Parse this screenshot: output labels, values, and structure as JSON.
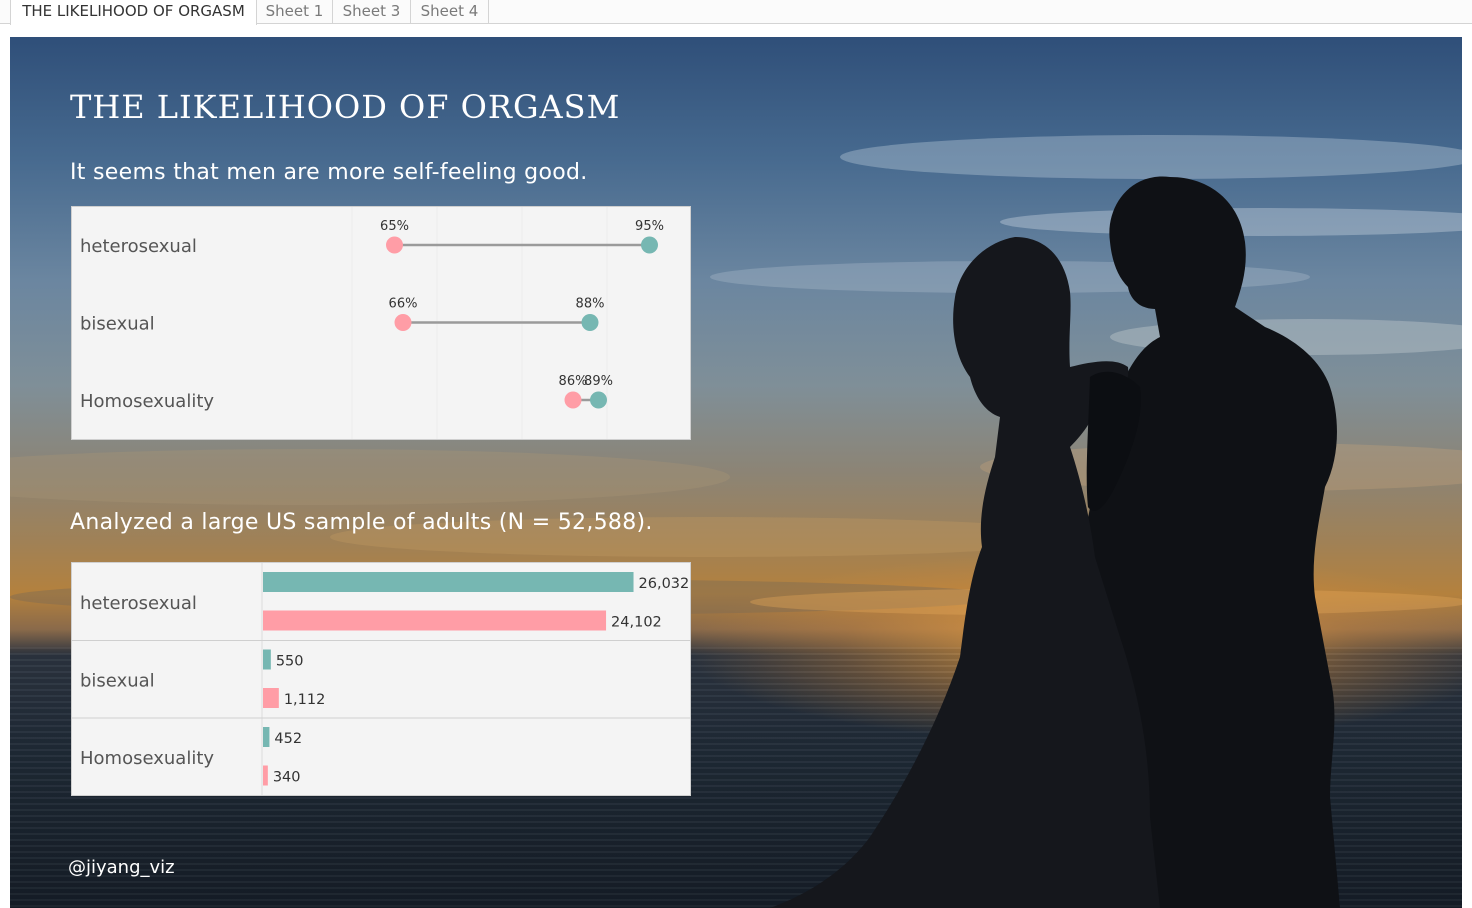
{
  "tabs": [
    {
      "label": "THE LIKELIHOOD OF ORGASM",
      "active": true
    },
    {
      "label": "Sheet 1",
      "active": false
    },
    {
      "label": "Sheet 3",
      "active": false
    },
    {
      "label": "Sheet 4",
      "active": false
    }
  ],
  "dashboard": {
    "title": "THE LIKELIHOOD OF ORGASM",
    "subtitle_dumbbell": "It seems that men are more self-feeling good.",
    "subtitle_bars": "Analyzed a large US sample of adults (N = 52,588).",
    "credit": "@jiyang_viz"
  },
  "colors": {
    "pink": "#ff9da6",
    "teal": "#76b7b2",
    "connector": "#9a9a9a",
    "panel_bg": "#f4f4f4",
    "label_text": "#555555"
  },
  "chart_data": [
    {
      "type": "dumbbell",
      "categories": [
        "heterosexual",
        "bisexual",
        "Homosexuality"
      ],
      "series": [
        {
          "color": "pink",
          "values": [
            65,
            66,
            86
          ],
          "labels": [
            "65%",
            "66%",
            "86%"
          ]
        },
        {
          "color": "teal",
          "values": [
            95,
            88,
            89
          ],
          "labels": [
            "95%",
            "88%",
            "89%"
          ]
        }
      ],
      "unit": "%",
      "xlim": [
        50,
        100
      ],
      "grid": false
    },
    {
      "type": "bar",
      "orientation": "horizontal",
      "categories": [
        "heterosexual",
        "bisexual",
        "Homosexuality"
      ],
      "series": [
        {
          "color": "teal",
          "values": [
            26032,
            550,
            452
          ],
          "labels": [
            "26,032",
            "550",
            "452"
          ]
        },
        {
          "color": "pink",
          "values": [
            24102,
            1112,
            340
          ],
          "labels": [
            "24,102",
            "1,112",
            "340"
          ]
        }
      ],
      "xlim": [
        0,
        30000
      ],
      "grid": false
    }
  ]
}
